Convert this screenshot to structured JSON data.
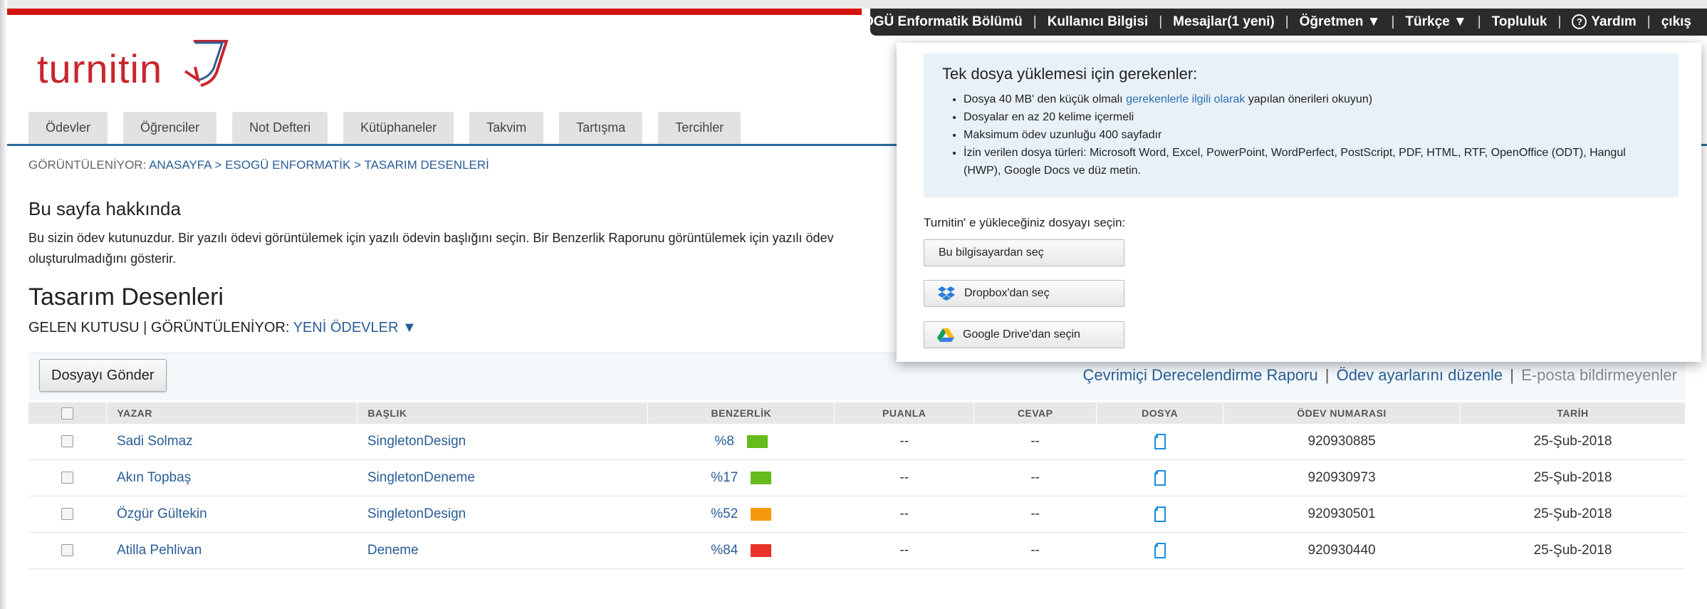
{
  "topnav": {
    "items": [
      "ESOGÜ Enformatik Bölümü",
      "Kullanıcı Bilgisi",
      "Mesajlar(1 yeni)",
      "Öğretmen ▼",
      "Türkçe ▼",
      "Topluluk",
      "Yardım",
      "çıkış"
    ]
  },
  "logo": {
    "text": "turnitin"
  },
  "tabs": [
    "Ödevler",
    "Öğrenciler",
    "Not Defteri",
    "Kütüphaneler",
    "Takvim",
    "Tartışma",
    "Tercihler"
  ],
  "breadcrumb": {
    "prefix": "GÖRÜNTÜLENİYOR:",
    "home": "ANASAYFA",
    "sep1": ">",
    "course": "ESOGÜ ENFORMATİK",
    "sep2": ">",
    "current": "TASARIM DESENLERİ"
  },
  "about": {
    "title": "Bu sayfa hakkında",
    "text": "Bu sizin ödev kutunuzdur. Bir yazılı ödevi görüntülemek için yazılı ödevin başlığını seçin. Bir Benzerlik Raporunu görüntülemek için yazılı ödev",
    "text2": "oluşturulmadığını gösterir."
  },
  "assignment": {
    "title": "Tasarım Desenleri",
    "inbox": "GELEN KUTUSU",
    "sep": "|",
    "viewing": "GÖRÜNTÜLENİYOR:",
    "view_value": "YENİ ÖDEVLER ▼"
  },
  "toolbar": {
    "submit": "Dosyayı Gönder",
    "grading_report": "Çevrimiçi Derecelendirme Raporu",
    "pipe1": "|",
    "edit_settings": "Ödev ayarlarını düzenle",
    "pipe2": "|",
    "email_non": "E-posta bildirmeyenler"
  },
  "table": {
    "headers": [
      "YAZAR",
      "BAŞLIK",
      "BENZERLİK",
      "PUANLA",
      "CEVAP",
      "DOSYA",
      "ÖDEV NUMARASI",
      "TARİH"
    ],
    "rows": [
      {
        "author": "Sadi Solmaz",
        "title": "SingletonDesign",
        "similarity": "%8",
        "similarity_color": "#65bb1b",
        "grade": "--",
        "response": "--",
        "paper_id": "920930885",
        "date": "25-Şub-2018"
      },
      {
        "author": "Akın Topbaş",
        "title": "SingletonDeneme",
        "similarity": "%17",
        "similarity_color": "#65bb1b",
        "grade": "--",
        "response": "--",
        "paper_id": "920930973",
        "date": "25-Şub-2018"
      },
      {
        "author": "Özgür Gültekin",
        "title": "SingletonDesign",
        "similarity": "%52",
        "similarity_color": "#f49a0c",
        "grade": "--",
        "response": "--",
        "paper_id": "920930501",
        "date": "25-Şub-2018"
      },
      {
        "author": "Atilla Pehlivan",
        "title": "Deneme",
        "similarity": "%84",
        "similarity_color": "#e8322a",
        "grade": "--",
        "response": "--",
        "paper_id": "920930440",
        "date": "25-Şub-2018"
      }
    ]
  },
  "upload": {
    "req_title": "Tek dosya yüklemesi için gerekenler:",
    "req1_a": "Dosya 40 MB' den küçük olmalı",
    "req1_link": "gerekenlerle ilgili olarak",
    "req1_b": "yapılan önerileri okuyun)",
    "req2": "Dosyalar en az 20 kelime içermeli",
    "req3": "Maksimum ödev uzunluğu 400 sayfadır",
    "req4": "İzin verilen dosya türleri: Microsoft Word, Excel, PowerPoint, WordPerfect, PostScript, PDF, HTML, RTF, OpenOffice (ODT), Hangul (HWP), Google Docs ve düz metin.",
    "choose_label": "Turnitin' e yükleceğiniz dosyayı seçin:",
    "btn_computer": "Bu bilgisayardan seç",
    "btn_dropbox": "Dropbox'dan seç",
    "btn_drive": "Google Drive'dan seçin"
  },
  "colors": {
    "brand_red": "#c8262d",
    "link_blue": "#2a5d96",
    "tab_rule": "#2a6d9e"
  }
}
